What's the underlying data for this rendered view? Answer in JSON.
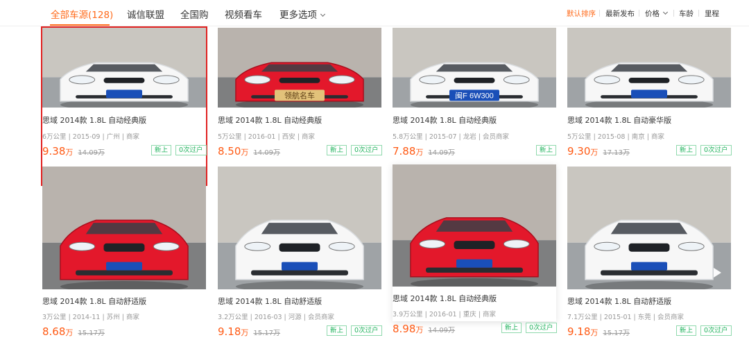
{
  "nav": {
    "tabs": [
      {
        "label": "全部车源(128)"
      },
      {
        "label": "诚信联盟"
      },
      {
        "label": "全国购"
      },
      {
        "label": "视频看车"
      },
      {
        "label": "更多选项"
      }
    ],
    "sort": [
      {
        "label": "默认排序"
      },
      {
        "label": "最新发布"
      },
      {
        "label": "价格"
      },
      {
        "label": "车龄"
      },
      {
        "label": "里程"
      }
    ]
  },
  "colors": {
    "accent": "#ff6a1a",
    "price": "#ff5a14",
    "badge": "#22b35e",
    "selected_outline": "#e02020"
  },
  "cars": [
    {
      "title": "思域 2014款 1.8L 自动经典版",
      "meta": "6万公里 | 2015-09 | 广州 | 商家",
      "price": "9.38",
      "unit": "万",
      "orig": "14.09万",
      "badges": [
        "新上",
        "0次过户"
      ]
    },
    {
      "title": "思域 2014款 1.8L 自动经典版",
      "meta": "5万公里 | 2016-01 | 西安 | 商家",
      "price": "8.50",
      "unit": "万",
      "orig": "14.09万",
      "badges": [
        "新上",
        "0次过户"
      ]
    },
    {
      "title": "思域 2014款 1.8L 自动经典版",
      "meta": "5.8万公里 | 2015-07 | 龙岩 | 会员商家",
      "price": "7.88",
      "unit": "万",
      "orig": "14.09万",
      "badges": [
        "新上"
      ]
    },
    {
      "title": "思域 2014款 1.8L 自动豪华版",
      "meta": "5万公里 | 2015-08 | 南京 | 商家",
      "price": "9.30",
      "unit": "万",
      "orig": "17.13万",
      "badges": [
        "新上",
        "0次过户"
      ]
    },
    {
      "title": "思域 2014款 1.8L 自动舒适版",
      "meta": "3万公里 | 2014-11 | 苏州 | 商家",
      "price": "8.68",
      "unit": "万",
      "orig": "15.17万",
      "badges": []
    },
    {
      "title": "思域 2014款 1.8L 自动舒适版",
      "meta": "3.2万公里 | 2016-03 | 河源 | 会员商家",
      "price": "9.18",
      "unit": "万",
      "orig": "15.17万",
      "badges": [
        "新上",
        "0次过户"
      ]
    },
    {
      "title": "思域 2014款 1.8L 自动经典版",
      "meta": "3.9万公里 | 2016-01 | 重庆 | 商家",
      "price": "8.98",
      "unit": "万",
      "orig": "14.09万",
      "badges": [
        "新上",
        "0次过户"
      ]
    },
    {
      "title": "思域 2014款 1.8L 自动舒适版",
      "meta": "7.1万公里 | 2015-01 | 东莞 | 会员商家",
      "price": "9.18",
      "unit": "万",
      "orig": "15.17万",
      "badges": [
        "新上",
        "0次过户"
      ]
    }
  ],
  "plates": [
    "",
    "领航名车",
    "闽F 6W300",
    "",
    "",
    "",
    "",
    ""
  ],
  "car_colors": [
    "white",
    "red",
    "white",
    "white",
    "red",
    "white",
    "red",
    "white"
  ]
}
